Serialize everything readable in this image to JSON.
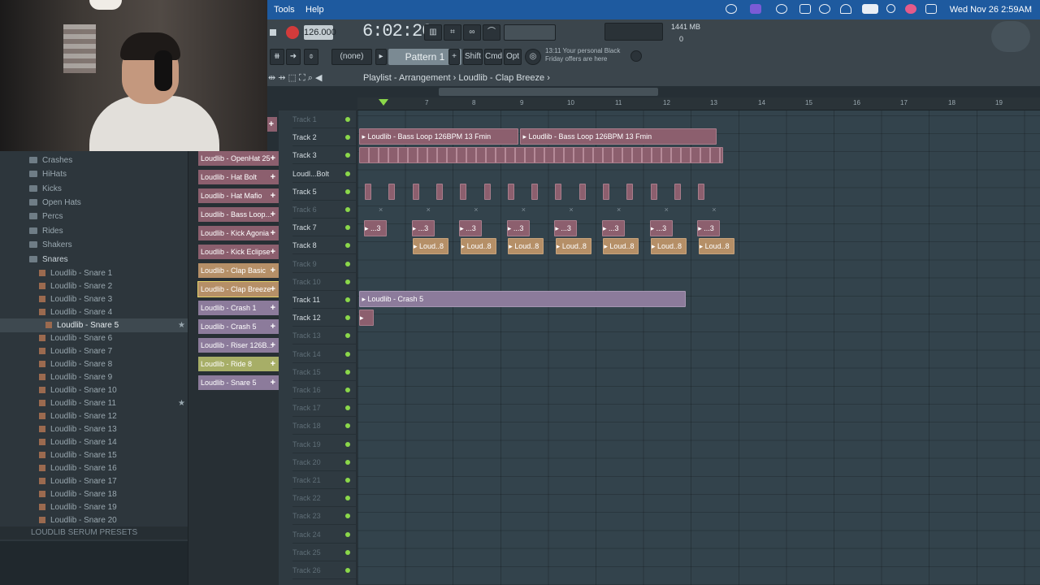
{
  "menubar": {
    "items": [
      "Tools",
      "Help"
    ],
    "clock": "Wed Nov 26  2:59AM"
  },
  "transport": {
    "tempo": "126.000",
    "time": "6:02:20",
    "pattern": "Pattern 1",
    "pattern_none": "(none)",
    "shift": "Shift",
    "cmd": "Cmd",
    "opt": "Opt",
    "promo": "13:11  Your personal Black Friday offers are here",
    "memory": "1441 MB",
    "cpu": "0"
  },
  "playlist": {
    "title": "Playlist - Arrangement  ›  Loudlib - Clap Breeze  ›"
  },
  "ruler": [
    "7",
    "8",
    "9",
    "10",
    "11",
    "12",
    "13",
    "14",
    "15",
    "16",
    "17",
    "18",
    "19"
  ],
  "browser": {
    "folders": [
      "Crashes",
      "HiHats",
      "Kicks",
      "Open Hats",
      "Percs",
      "Rides",
      "Shakers",
      "Snares"
    ],
    "snares": [
      "Loudlib - Snare 1",
      "Loudlib - Snare 2",
      "Loudlib - Snare 3",
      "Loudlib - Snare 4",
      "Loudlib - Snare 5",
      "Loudlib - Snare 6",
      "Loudlib - Snare 7",
      "Loudlib - Snare 8",
      "Loudlib - Snare 9",
      "Loudlib - Snare 10",
      "Loudlib - Snare 11",
      "Loudlib - Snare 12",
      "Loudlib - Snare 13",
      "Loudlib - Snare 14",
      "Loudlib - Snare 15",
      "Loudlib - Snare 16",
      "Loudlib - Snare 17",
      "Loudlib - Snare 18",
      "Loudlib - Snare 19",
      "Loudlib - Snare 20"
    ],
    "selected": "Loudlib - Snare 5",
    "serum": "LOUDLIB SERUM PRESETS"
  },
  "channels": [
    {
      "name": "Loudlib - OpenHat 25",
      "color": "#8c5f6e"
    },
    {
      "name": "Loudlib - Hat Bolt",
      "color": "#8c5f6e"
    },
    {
      "name": "Loudlib - Hat Mafio",
      "color": "#8c5f6e"
    },
    {
      "name": "Loudlib - Bass Loop...",
      "color": "#8c5f6e"
    },
    {
      "name": "Loudlib - Kick Agonia",
      "color": "#8c5f6e"
    },
    {
      "name": "Loudlib - Kick Eclipse",
      "color": "#8c5f6e"
    },
    {
      "name": "Loudlib - Clap Basic",
      "color": "#b58f67"
    },
    {
      "name": "Loudlib - Clap Breeze",
      "color": "#b58f67"
    },
    {
      "name": "Loudlib - Crash 1",
      "color": "#8c7b9b"
    },
    {
      "name": "Loudlib - Crash 5",
      "color": "#8c7b9b"
    },
    {
      "name": "Loudlib - Riser 126B...",
      "color": "#8c7b9b"
    },
    {
      "name": "Loudlib - Ride 8",
      "color": "#a7ae67"
    },
    {
      "name": "Loudlib - Snare 5",
      "color": "#8c7b9b"
    }
  ],
  "tracks": [
    "Track 1",
    "Track 2",
    "Track 3",
    "Loudl...Bolt",
    "Track 5",
    "Track 6",
    "Track 7",
    "Track 8",
    "Track 9",
    "Track 10",
    "Track 11",
    "Track 12",
    "Track 13",
    "Track 14",
    "Track 15",
    "Track 16",
    "Track 17",
    "Track 18",
    "Track 19",
    "Track 20",
    "Track 21",
    "Track 22",
    "Track 23",
    "Track 24",
    "Track 25",
    "Track 26"
  ],
  "clips": {
    "bass1": "Loudlib - Bass Loop 126BPM 13 Fmin",
    "bass2": "Loudlib - Bass Loop 126BPM 13 Fmin",
    "crash": "Loudlib - Crash 5",
    "short3": "...3",
    "loud8": "Loud..8"
  }
}
